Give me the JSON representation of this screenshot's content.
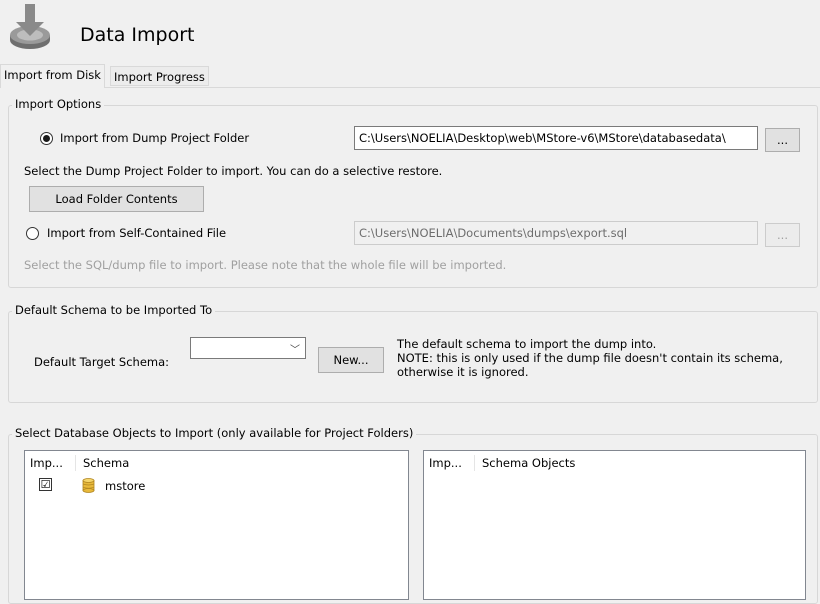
{
  "header": {
    "title": "Data Import",
    "icon": "import-download-icon"
  },
  "tabs": [
    {
      "label": "Import from Disk",
      "active": true
    },
    {
      "label": "Import Progress",
      "active": false
    }
  ],
  "import_options": {
    "group_title": "Import Options",
    "dump_folder": {
      "label": "Import from Dump Project Folder",
      "selected": true,
      "path": "C:\\Users\\NOELIA\\Desktop\\web\\MStore-v6\\MStore\\databasedata\\",
      "browse_label": "..."
    },
    "hint_folder": "Select the Dump Project Folder to import. You can do a selective restore.",
    "load_folder_label": "Load Folder Contents",
    "self_contained": {
      "label": "Import from Self-Contained File",
      "selected": false,
      "path": "C:\\Users\\NOELIA\\Documents\\dumps\\export.sql",
      "browse_label": "..."
    },
    "hint_file": "Select the SQL/dump file to import. Please note that the whole file will be imported."
  },
  "default_schema": {
    "group_title": "Default Schema to be Imported To",
    "target_label": "Default Target Schema:",
    "target_value": "",
    "new_label": "New...",
    "note_line1": "The default schema to import the dump into.",
    "note_line2": "NOTE: this is only used if the dump file doesn't contain its schema,",
    "note_line3": "otherwise it is ignored."
  },
  "objects": {
    "group_title": "Select Database Objects to Import (only available for Project Folders)",
    "schema_list": {
      "col_import": "Imp...",
      "col_schema": "Schema",
      "rows": [
        {
          "checked": true,
          "check_glyph": "☑",
          "name": "mstore",
          "icon": "database-icon"
        }
      ]
    },
    "objects_list": {
      "col_import": "Imp...",
      "col_objects": "Schema Objects"
    }
  },
  "colors": {
    "background": "#f0f0f0",
    "db_icon": "#e8b93a",
    "border": "#d7d7d7"
  }
}
